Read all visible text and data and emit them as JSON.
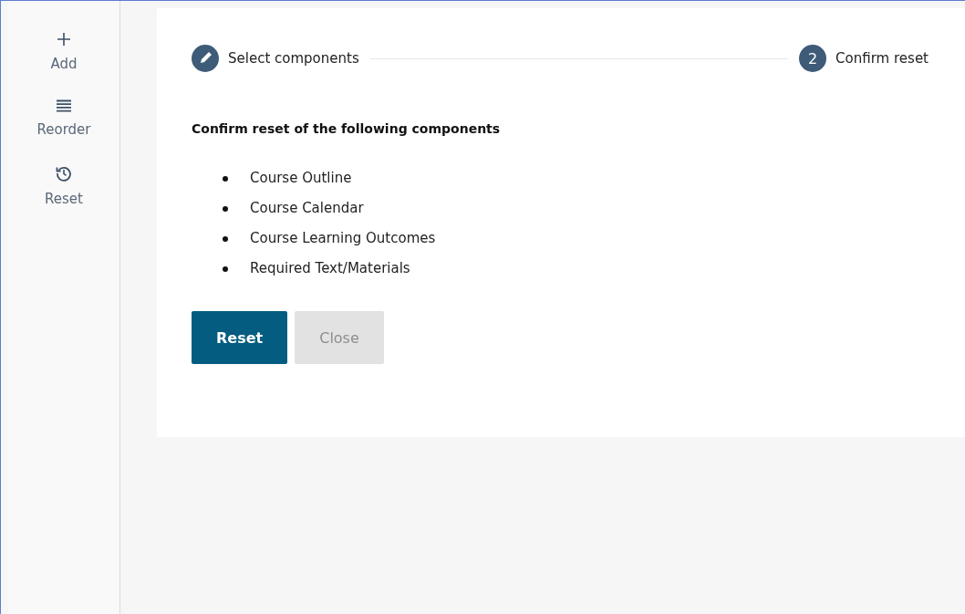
{
  "sidebar": {
    "items": [
      {
        "kind": "add",
        "label": "Add"
      },
      {
        "kind": "reorder",
        "label": "Reorder"
      },
      {
        "kind": "reset",
        "label": "Reset"
      }
    ]
  },
  "stepper": {
    "steps": [
      {
        "kind": "edit",
        "label": "Select components"
      },
      {
        "kind": "number",
        "number": "2",
        "label": "Confirm reset"
      }
    ]
  },
  "heading": "Confirm reset of the following components",
  "components": [
    "Course Outline",
    "Course Calendar",
    "Course Learning Outcomes",
    "Required Text/Materials"
  ],
  "buttons": [
    {
      "label": "Reset",
      "disabled": false
    },
    {
      "label": "Close",
      "disabled": true
    }
  ]
}
